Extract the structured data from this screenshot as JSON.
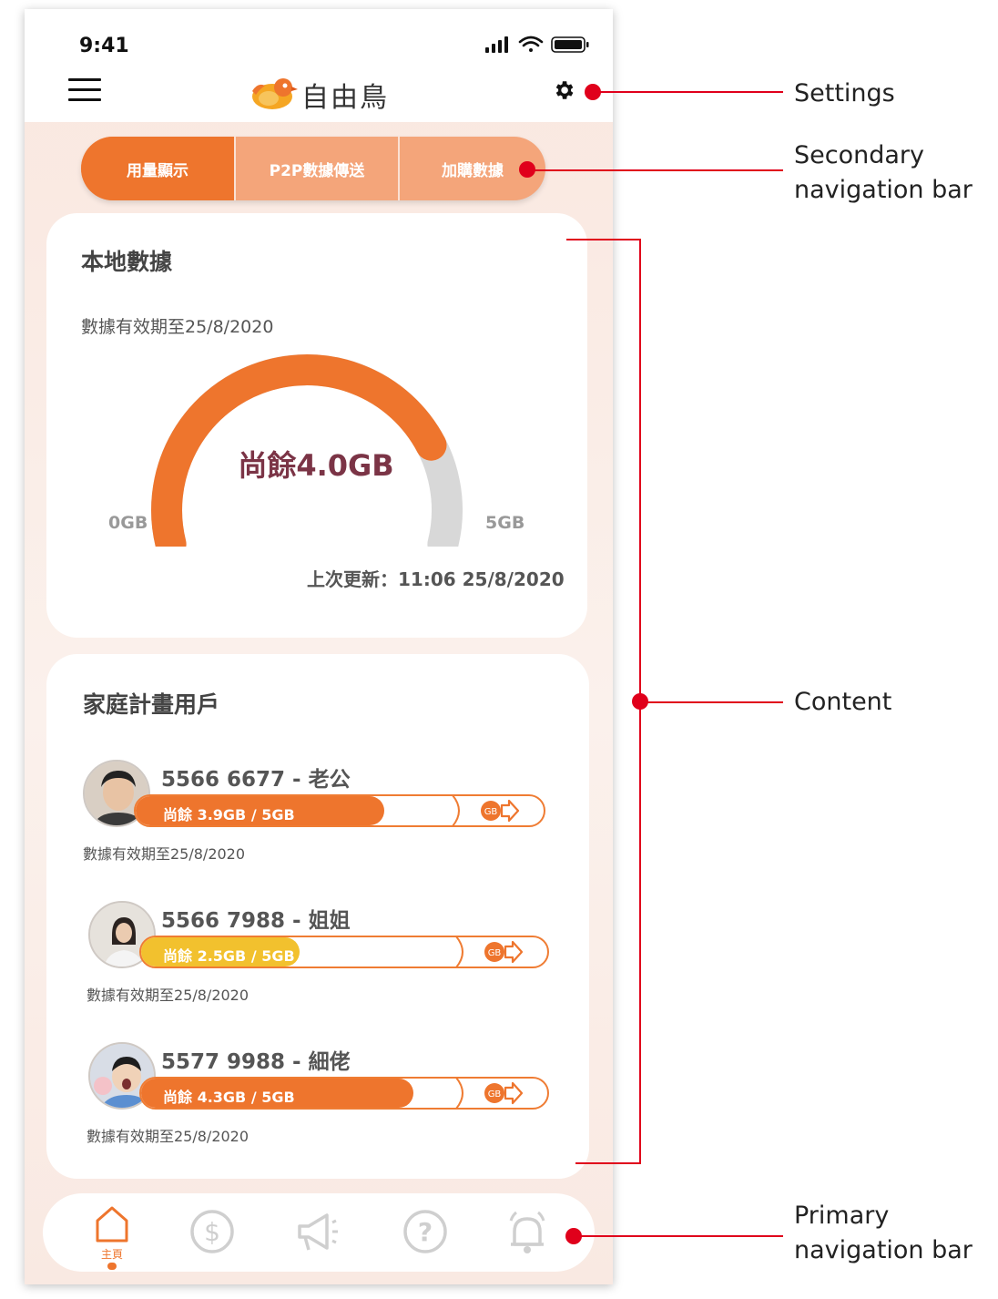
{
  "status_bar": {
    "time": "9:41"
  },
  "header": {
    "logo_text": "自由鳥",
    "tm": "™"
  },
  "secondary_nav": {
    "tabs": [
      {
        "label": "用量顯示",
        "active": true
      },
      {
        "label": "P2P數據傳送",
        "active": false
      },
      {
        "label": "加購數據",
        "active": false
      }
    ]
  },
  "local_data": {
    "title": "本地數據",
    "expiry": "數據有效期至25/8/2020",
    "remaining": "尚餘4.0GB",
    "remaining_gb": 4.0,
    "total_gb": 5,
    "min_label": "0GB",
    "max_label": "5GB",
    "updated": "上次更新：11:06 25/8/2020"
  },
  "family": {
    "title": "家庭計畫用戶",
    "members": [
      {
        "name": "5566 6677 - 老公",
        "usage": "尚餘 3.9GB / 5GB",
        "fraction": 0.78,
        "color": "#ee752d",
        "expiry": "數據有效期至25/8/2020",
        "gb_label": "GB"
      },
      {
        "name": "5566 7988 - 姐姐",
        "usage": "尚餘 2.5GB / 5GB",
        "fraction": 0.5,
        "color": "#f2c12e",
        "expiry": "數據有效期至25/8/2020",
        "gb_label": "GB"
      },
      {
        "name": "5577 9988 - 細佬",
        "usage": "尚餘 4.3GB / 5GB",
        "fraction": 0.86,
        "color": "#ee752d",
        "expiry": "數據有效期至25/8/2020",
        "gb_label": "GB"
      }
    ]
  },
  "primary_nav": {
    "home_label": "主頁"
  },
  "annotations": {
    "settings": "Settings",
    "secondary_nav": [
      "Secondary",
      "navigation bar"
    ],
    "content": "Content",
    "primary_nav": [
      "Primary",
      "navigation bar"
    ]
  },
  "colors": {
    "accent": "#ee752d",
    "annotation": "#e0001b",
    "gauge_track": "#d8d8d8"
  }
}
